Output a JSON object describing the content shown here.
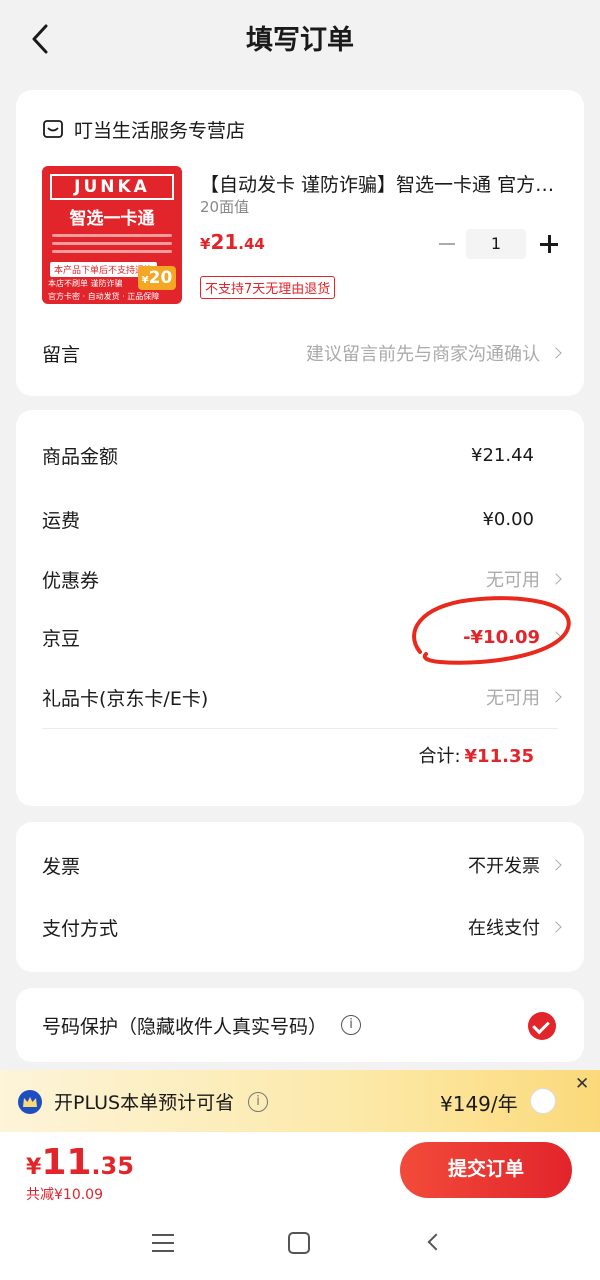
{
  "header": {
    "title": "填写订单"
  },
  "shop": {
    "name": "叮当生活服务专营店"
  },
  "product": {
    "image": {
      "brand": "JUNKA",
      "name": "智选一卡通",
      "note": "本产品下单后不支持退换",
      "foot1": "本店不刷单  谨防诈骗",
      "foot2": "官方卡密 · 自动发货 · 正品保障",
      "badge": "20",
      "badge_currency": "¥"
    },
    "title": "【自动发卡 谨防诈骗】智选一卡通  官方卡密",
    "spec": "20面值",
    "price_currency": "¥",
    "price_int": "21",
    "price_dec": ".44",
    "quantity": "1",
    "return_tag": "不支持7天无理由退货"
  },
  "message": {
    "label": "留言",
    "placeholder": "建议留言前先与商家沟通确认"
  },
  "summary": {
    "goods_label": "商品金额",
    "goods_value": "¥21.44",
    "shipping_label": "运费",
    "shipping_value": "¥0.00",
    "coupon_label": "优惠券",
    "coupon_value": "无可用",
    "jingdou_label": "京豆",
    "jingdou_value": "-¥10.09",
    "giftcard_label": "礼品卡(京东卡/E卡)",
    "giftcard_value": "无可用",
    "total_label": "合计:",
    "total_value": "¥11.35"
  },
  "invoice": {
    "invoice_label": "发票",
    "invoice_value": "不开发票",
    "payment_label": "支付方式",
    "payment_value": "在线支付"
  },
  "privacy": {
    "label": "号码保护（隐藏收件人真实号码）",
    "info": "i",
    "checked": true
  },
  "plus": {
    "text": "开PLUS本单预计可省",
    "info": "i",
    "price": "¥149/年",
    "close": "✕"
  },
  "bottom": {
    "currency": "¥",
    "price_int": "11",
    "price_dec": ".35",
    "saved": "共减¥10.09",
    "submit": "提交订单"
  },
  "colors": {
    "accent": "#e2242b",
    "annotation": "#e8291c",
    "background": "#f2f2f2"
  }
}
